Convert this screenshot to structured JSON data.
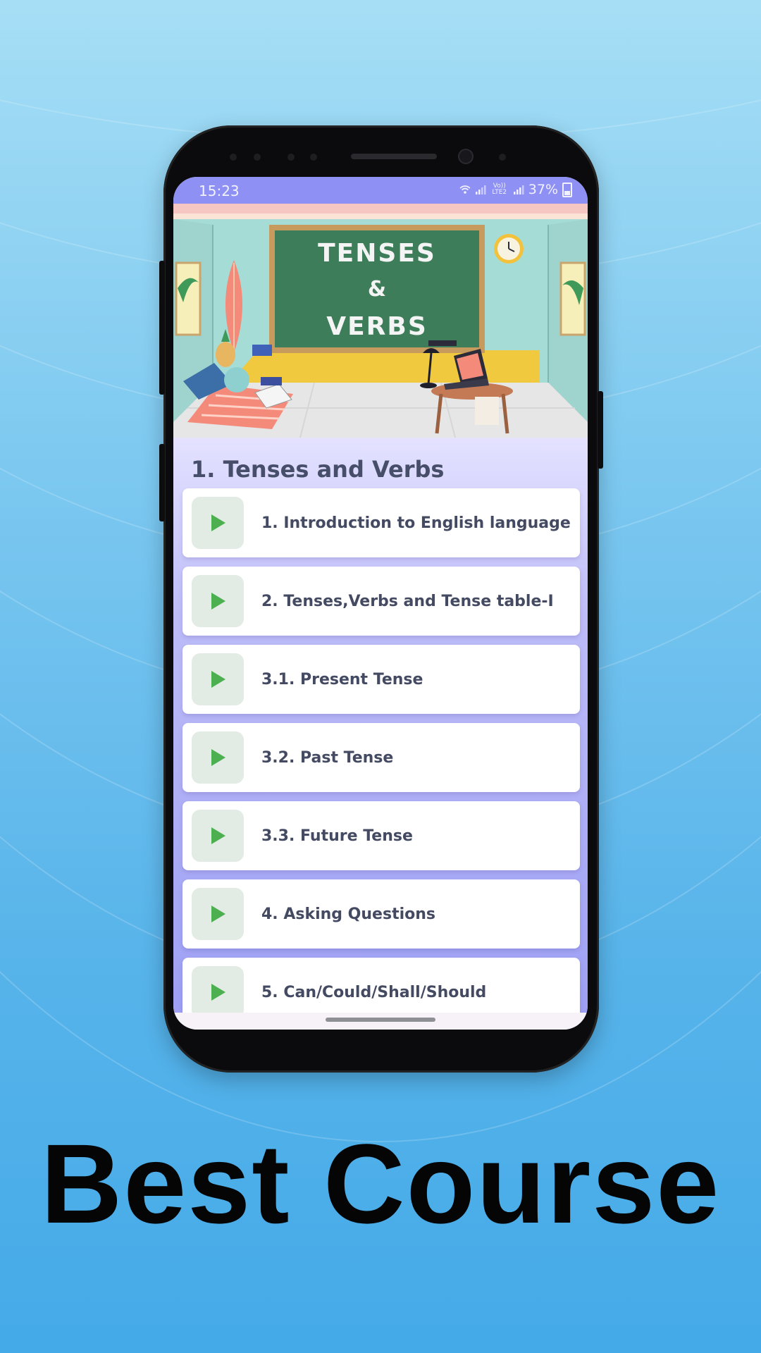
{
  "status_bar": {
    "time": "15:23",
    "network_label": "Vo)) LTE2",
    "battery": "37%"
  },
  "banner": {
    "board_line1": "TENSES",
    "board_line2": "&",
    "board_line3": "VERBS"
  },
  "course": {
    "section_title": "1. Tenses and Verbs",
    "lessons": [
      {
        "label": "1. Introduction to English language"
      },
      {
        "label": "2. Tenses,Verbs and Tense table-I"
      },
      {
        "label": "3.1. Present Tense"
      },
      {
        "label": "3.2. Past Tense"
      },
      {
        "label": "3.3. Future Tense"
      },
      {
        "label": "4. Asking Questions"
      },
      {
        "label": "5. Can/Could/Shall/Should"
      }
    ]
  },
  "tagline": "Best Course",
  "colors": {
    "accent": "#8e90f4",
    "play_icon": "#4caf50",
    "text": "#444a62"
  },
  "icons": [
    "wifi-icon",
    "signal-icon",
    "battery-icon",
    "play-icon"
  ]
}
